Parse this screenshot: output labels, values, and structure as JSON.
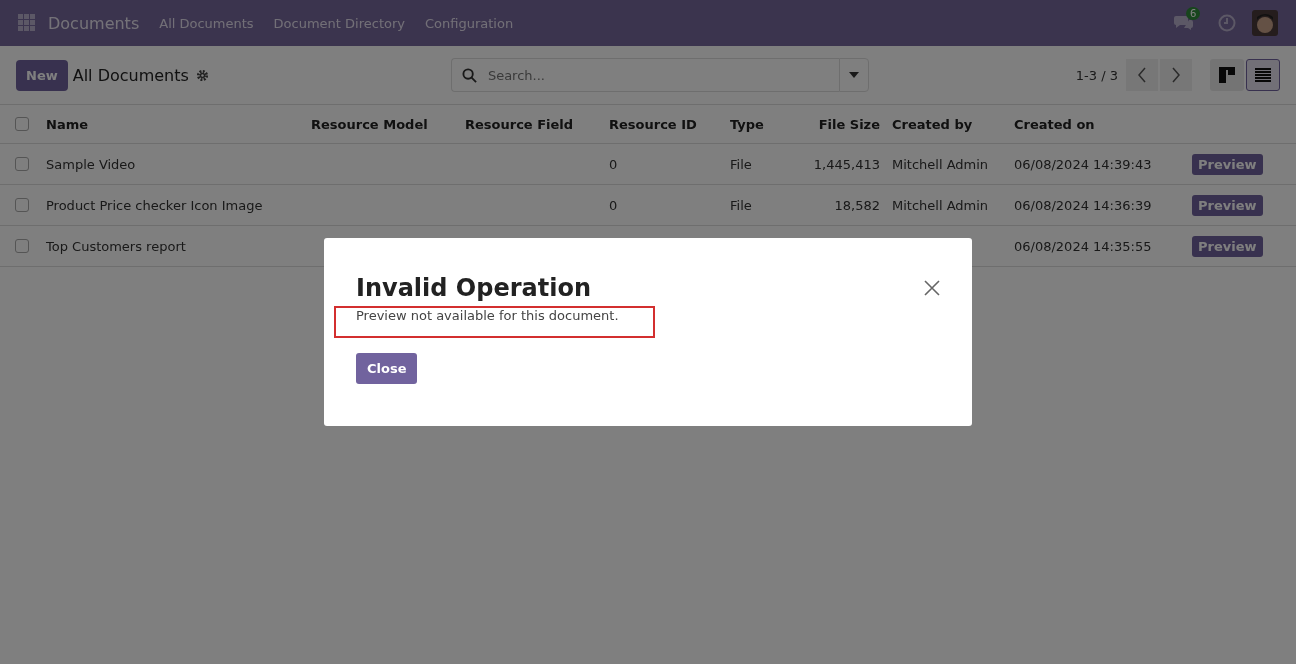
{
  "navbar": {
    "app_name": "Documents",
    "menu": [
      "All Documents",
      "Document Directory",
      "Configuration"
    ],
    "chat_count": "6"
  },
  "control_panel": {
    "new_button": "New",
    "breadcrumb": "All Documents",
    "search": {
      "placeholder": "Search..."
    },
    "pager": "1-3 / 3",
    "views": [
      {
        "kind": "kanban",
        "selected": false
      },
      {
        "kind": "list",
        "selected": true
      }
    ]
  },
  "table": {
    "columns": [
      "Name",
      "Resource Model",
      "Resource Field",
      "Resource ID",
      "Type",
      "File Size",
      "Created by",
      "Created on"
    ],
    "header_checked": false,
    "rows": [
      {
        "checked": false,
        "cells": [
          "Sample Video",
          "",
          "",
          "0",
          "File",
          "1,445,413",
          "Mitchell Admin",
          "06/08/2024 14:39:43"
        ],
        "action": "Preview"
      },
      {
        "checked": false,
        "cells": [
          "Product Price checker Icon Image",
          "",
          "",
          "0",
          "File",
          "18,582",
          "Mitchell Admin",
          "06/08/2024 14:36:39"
        ],
        "action": "Preview"
      },
      {
        "checked": false,
        "cells": [
          "Top Customers report",
          "",
          "",
          "",
          "",
          "",
          "",
          "06/08/2024 14:35:55"
        ],
        "action": "Preview"
      }
    ]
  },
  "dialog": {
    "title": "Invalid Operation",
    "message": "Preview not available for this document.",
    "button": "Close"
  }
}
